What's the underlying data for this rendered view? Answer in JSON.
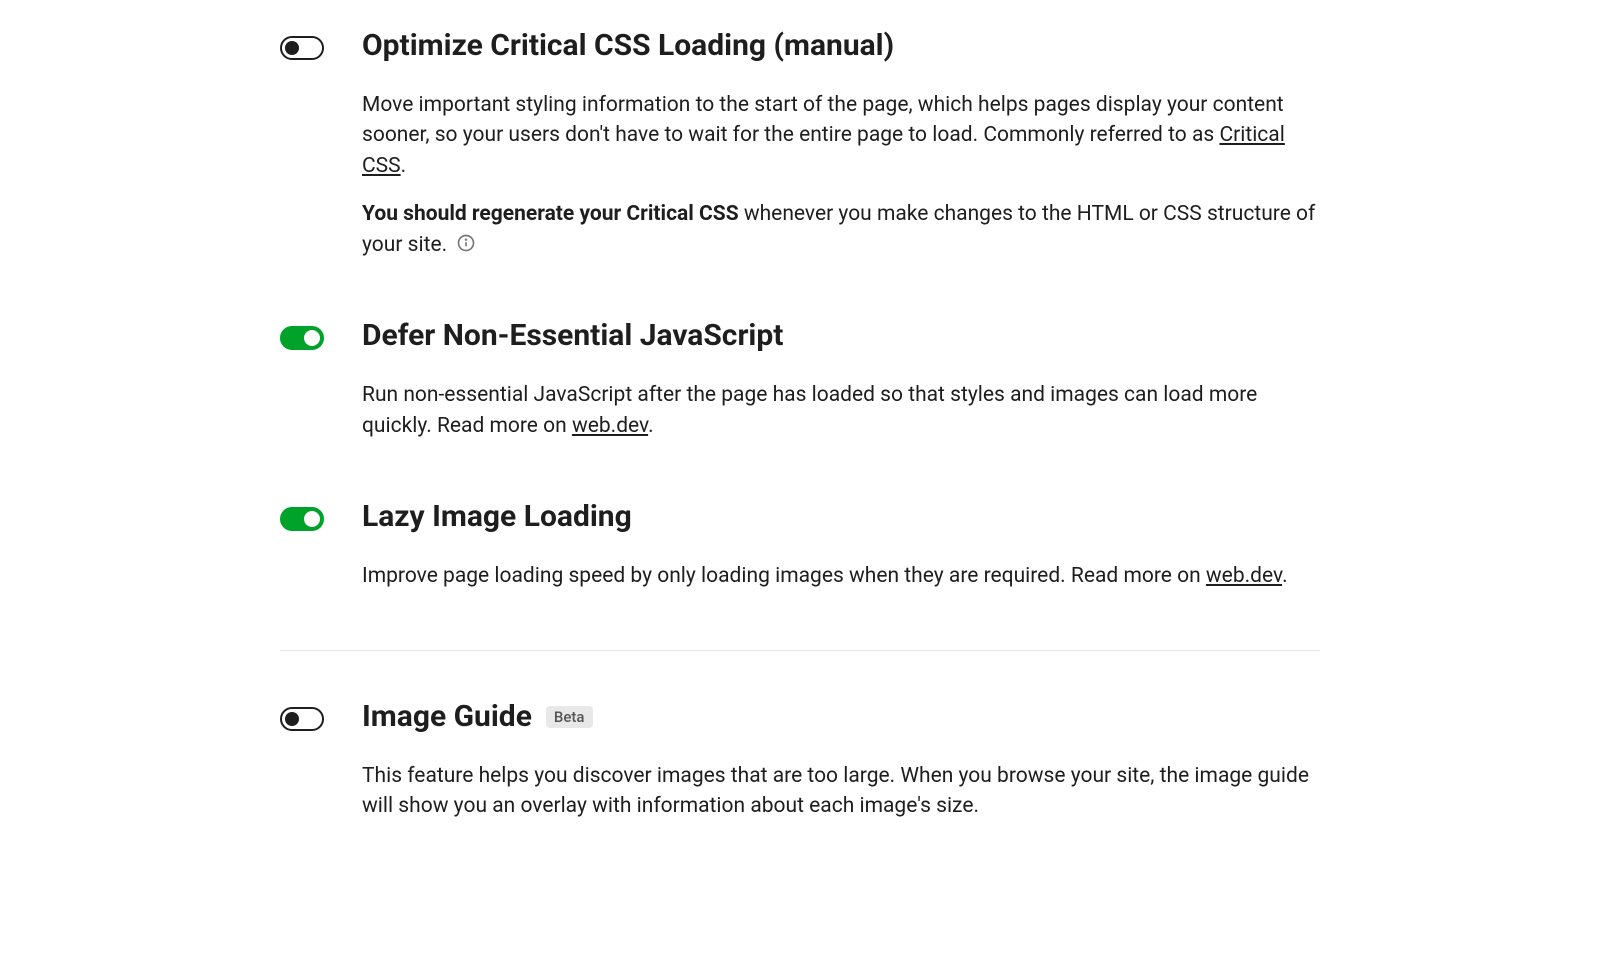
{
  "settings": {
    "critical_css": {
      "enabled": false,
      "title": "Optimize Critical CSS Loading (manual)",
      "desc_pre": "Move important styling information to the start of the page, which helps pages display your content sooner, so your users don't have to wait for the entire page to load. Commonly referred to as ",
      "desc_link": "Critical CSS",
      "desc_post": ".",
      "note_strong": "You should regenerate your Critical CSS",
      "note_rest": " whenever you make changes to the HTML or CSS structure of your site."
    },
    "defer_js": {
      "enabled": true,
      "title": "Defer Non-Essential JavaScript",
      "desc_pre": "Run non-essential JavaScript after the page has loaded so that styles and images can load more quickly. Read more on ",
      "desc_link": "web.dev",
      "desc_post": "."
    },
    "lazy_images": {
      "enabled": true,
      "title": "Lazy Image Loading",
      "desc_pre": "Improve page loading speed by only loading images when they are required. Read more on ",
      "desc_link": "web.dev",
      "desc_post": "."
    },
    "image_guide": {
      "enabled": false,
      "title": "Image Guide",
      "badge": "Beta",
      "desc": "This feature helps you discover images that are too large. When you browse your site, the image guide will show you an overlay with information about each image's size."
    }
  }
}
